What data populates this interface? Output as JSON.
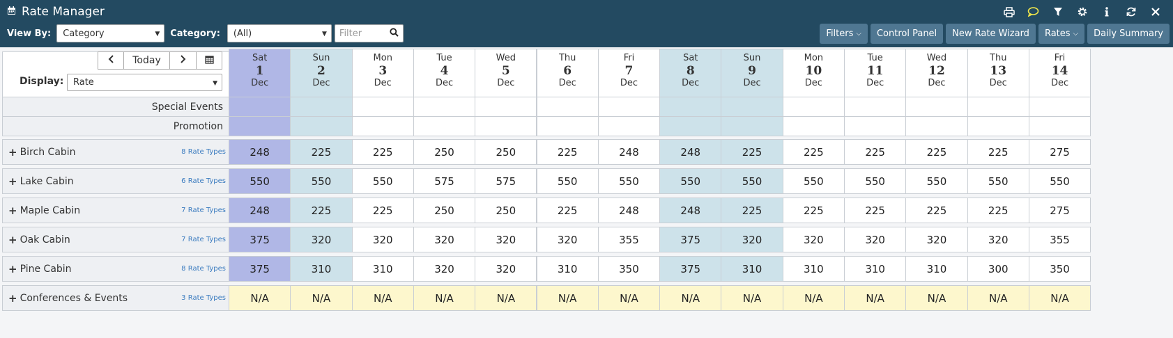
{
  "app": {
    "title": "Rate Manager",
    "icons": [
      "calendar-icon",
      "print-icon",
      "chat-icon",
      "filter-icon",
      "gear-icon",
      "info-icon",
      "refresh-icon",
      "close-icon"
    ]
  },
  "toolbar": {
    "view_by_label": "View By:",
    "view_by_value": "Category",
    "category_label": "Category:",
    "category_value": "(All)",
    "filter_placeholder": "Filter",
    "buttons": [
      "Filters",
      "Control Panel",
      "New Rate Wizard",
      "Rates",
      "Daily Summary"
    ]
  },
  "nav": {
    "today_label": "Today",
    "display_label": "Display:",
    "display_value": "Rate"
  },
  "days": [
    {
      "dow": "Sat",
      "num": "1",
      "mon": "Dec",
      "type": "sat"
    },
    {
      "dow": "Sun",
      "num": "2",
      "mon": "Dec",
      "type": "sun"
    },
    {
      "dow": "Mon",
      "num": "3",
      "mon": "Dec",
      "type": ""
    },
    {
      "dow": "Tue",
      "num": "4",
      "mon": "Dec",
      "type": ""
    },
    {
      "dow": "Wed",
      "num": "5",
      "mon": "Dec",
      "type": ""
    },
    {
      "dow": "Thu",
      "num": "6",
      "mon": "Dec",
      "type": ""
    },
    {
      "dow": "Fri",
      "num": "7",
      "mon": "Dec",
      "type": ""
    },
    {
      "dow": "Sat",
      "num": "8",
      "mon": "Dec",
      "type": "sun"
    },
    {
      "dow": "Sun",
      "num": "9",
      "mon": "Dec",
      "type": "sun"
    },
    {
      "dow": "Mon",
      "num": "10",
      "mon": "Dec",
      "type": ""
    },
    {
      "dow": "Tue",
      "num": "11",
      "mon": "Dec",
      "type": ""
    },
    {
      "dow": "Wed",
      "num": "12",
      "mon": "Dec",
      "type": ""
    },
    {
      "dow": "Thu",
      "num": "13",
      "mon": "Dec",
      "type": ""
    },
    {
      "dow": "Fri",
      "num": "14",
      "mon": "Dec",
      "type": ""
    }
  ],
  "event_rows": [
    "Special Events",
    "Promotion"
  ],
  "rows": [
    {
      "name": "Birch Cabin",
      "rate_types": "8 Rate Types",
      "values": [
        "248",
        "225",
        "225",
        "250",
        "250",
        "225",
        "248",
        "248",
        "225",
        "225",
        "225",
        "225",
        "225",
        "275"
      ]
    },
    {
      "name": "Lake Cabin",
      "rate_types": "6 Rate Types",
      "values": [
        "550",
        "550",
        "550",
        "575",
        "575",
        "550",
        "550",
        "550",
        "550",
        "550",
        "550",
        "550",
        "550",
        "550"
      ]
    },
    {
      "name": "Maple Cabin",
      "rate_types": "7 Rate Types",
      "values": [
        "248",
        "225",
        "225",
        "250",
        "250",
        "225",
        "248",
        "248",
        "225",
        "225",
        "225",
        "225",
        "225",
        "275"
      ]
    },
    {
      "name": "Oak Cabin",
      "rate_types": "7 Rate Types",
      "values": [
        "375",
        "320",
        "320",
        "320",
        "320",
        "320",
        "355",
        "375",
        "320",
        "320",
        "320",
        "320",
        "320",
        "355"
      ]
    },
    {
      "name": "Pine Cabin",
      "rate_types": "8 Rate Types",
      "values": [
        "375",
        "310",
        "310",
        "320",
        "320",
        "310",
        "350",
        "375",
        "310",
        "310",
        "310",
        "310",
        "300",
        "350"
      ]
    },
    {
      "name": "Conferences & Events",
      "rate_types": "3 Rate Types",
      "values": [
        "N/A",
        "N/A",
        "N/A",
        "N/A",
        "N/A",
        "N/A",
        "N/A",
        "N/A",
        "N/A",
        "N/A",
        "N/A",
        "N/A",
        "N/A",
        "N/A"
      ]
    }
  ]
}
